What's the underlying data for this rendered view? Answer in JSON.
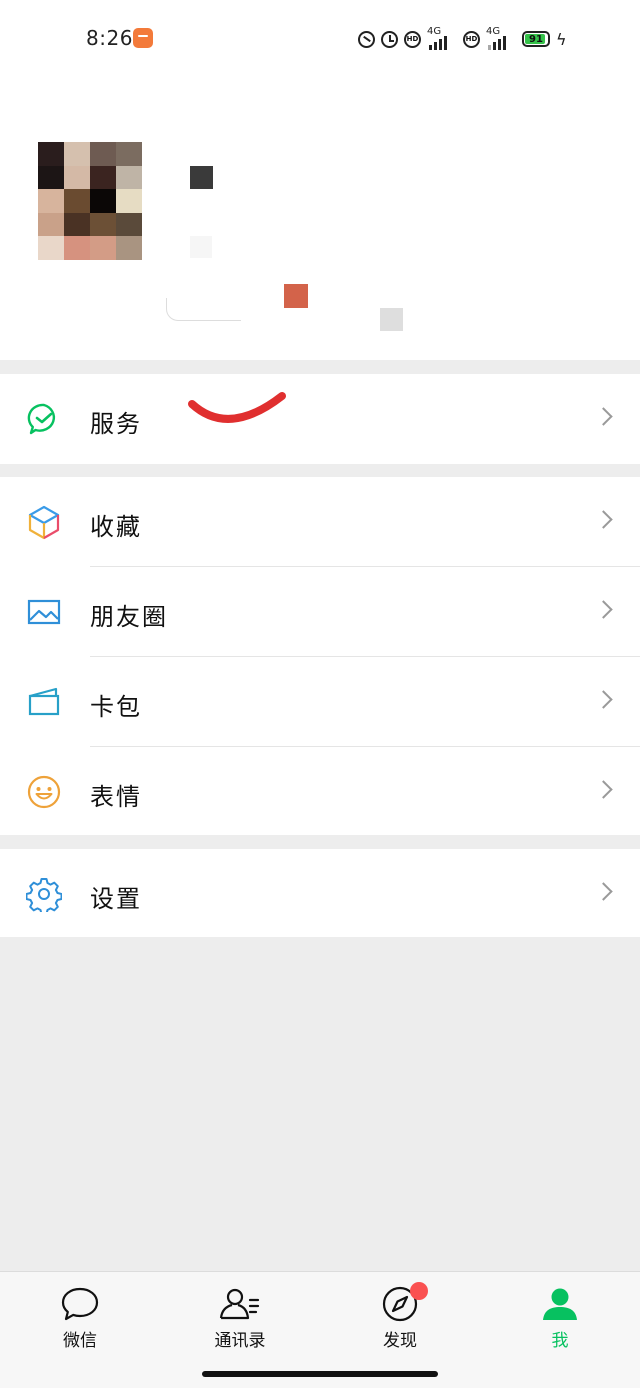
{
  "status": {
    "time": "8:26",
    "network1": "4G",
    "network2": "4G",
    "battery": "91"
  },
  "menu": {
    "services": "服务",
    "favorites": "收藏",
    "moments": "朋友圈",
    "cards": "卡包",
    "stickers": "表情",
    "settings": "设置"
  },
  "tabs": {
    "chats": "微信",
    "contacts": "通讯录",
    "discover": "发现",
    "me": "我"
  },
  "colors": {
    "accent": "#07c160",
    "badge": "#fa5151"
  }
}
